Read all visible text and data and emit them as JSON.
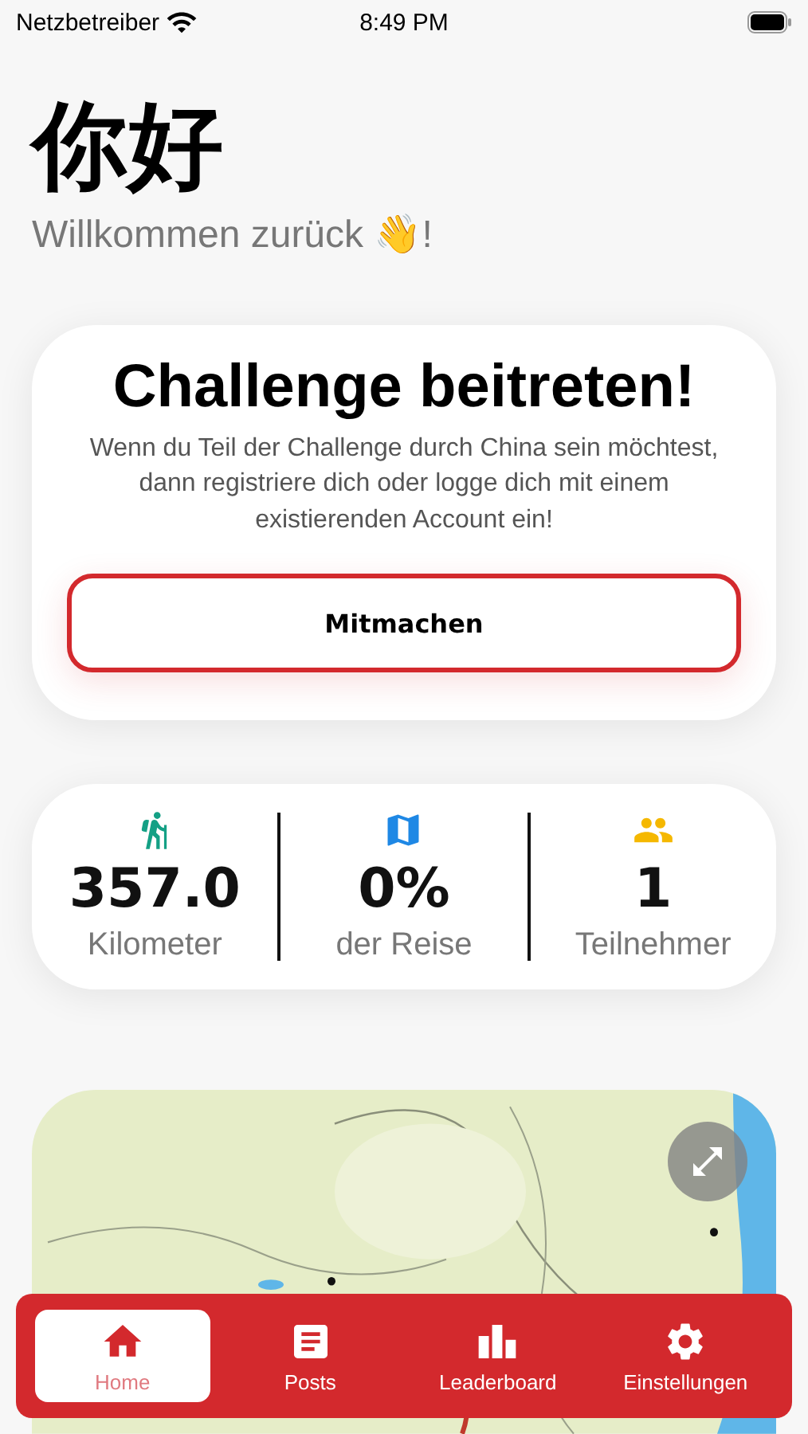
{
  "status_bar": {
    "carrier": "Netzbetreiber",
    "time": "8:49 PM"
  },
  "header": {
    "title": "你好",
    "subtitle": "Willkommen zurück 👋!"
  },
  "join_card": {
    "title": "Challenge beitreten!",
    "text": "Wenn du Teil der Challenge durch China sein möchtest, dann registriere dich oder logge dich mit einem existierenden Account ein!",
    "button": "Mitmachen"
  },
  "stats": [
    {
      "kind": "distance",
      "color": "#14a085",
      "value": "357.0",
      "label": "Kilometer"
    },
    {
      "kind": "progress",
      "color": "#1e88e5",
      "value": "0%",
      "label": "der Reise"
    },
    {
      "kind": "participants",
      "color": "#f5b800",
      "value": "1",
      "label": "Teilnehmer"
    }
  ],
  "tab_bar": [
    {
      "kind": "home",
      "label": "Home",
      "selected": true
    },
    {
      "kind": "posts",
      "label": "Posts",
      "selected": false
    },
    {
      "kind": "leaderboard",
      "label": "Leaderboard",
      "selected": false
    },
    {
      "kind": "settings",
      "label": "Einstellungen",
      "selected": false
    }
  ]
}
